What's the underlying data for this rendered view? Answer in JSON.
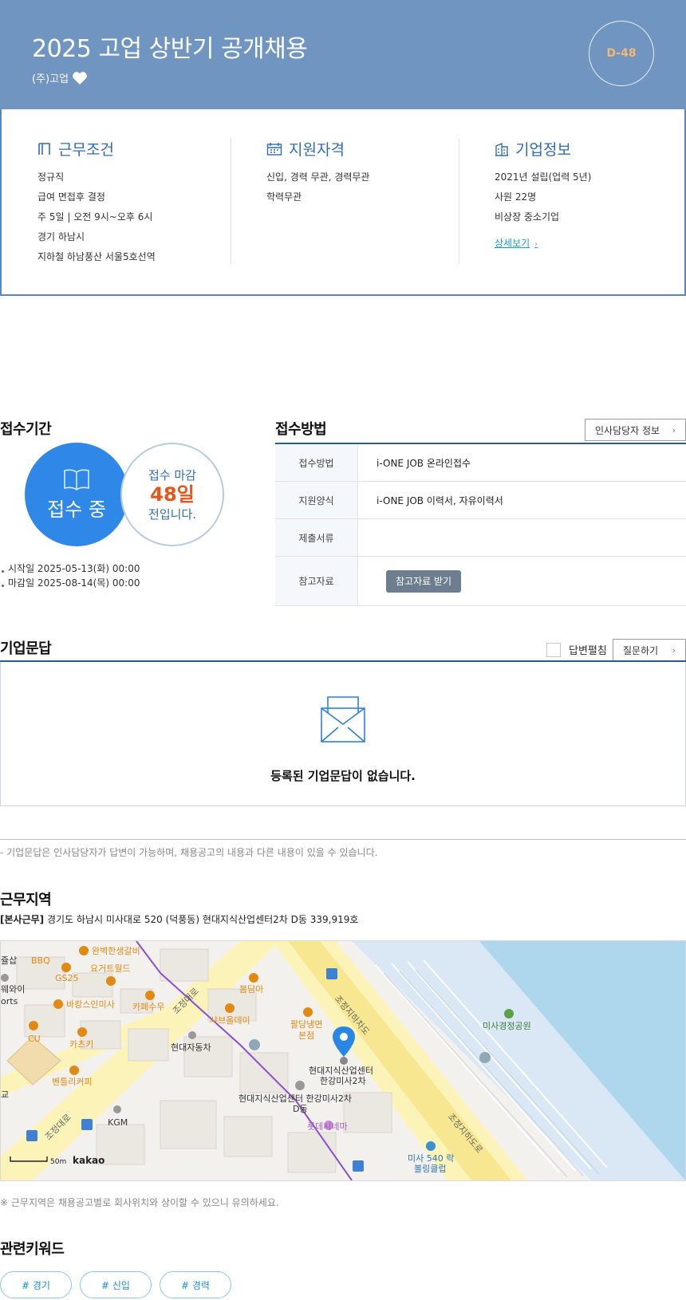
{
  "header": {
    "title": "2025 고업 상반기 공개채용",
    "company": "(주)고업",
    "dday": "D-48",
    "colors": {
      "banner": "#6f95c0",
      "accent": "#f3b77a"
    }
  },
  "summary": {
    "work_conditions": {
      "title": "근무조건",
      "lines": [
        "정규직",
        "급여 면접후 결정",
        "주 5일 | 오전 9시~오후 6시",
        "경기 하남시",
        "지하철 하남풍산 서울5호선역"
      ]
    },
    "qualifications": {
      "title": "지원자격",
      "lines": [
        "신입, 경력 무관, 경력무관",
        "학력무관"
      ]
    },
    "company_info": {
      "title": "기업정보",
      "lines": [
        "2021년 설립(업력 5년)",
        "사원 22명",
        "비상장 중소기업"
      ],
      "detail_link": "상세보기"
    }
  },
  "application_period": {
    "title": "접수기간",
    "status": "접수 중",
    "deadline_prefix": "접수 마감",
    "days_left": "48일",
    "deadline_suffix": "전입니다.",
    "start": "시작일 2025-05-13(화) 00:00",
    "end": "마감일 2025-08-14(목) 00:00"
  },
  "application_method": {
    "title": "접수방법",
    "hr_button": "인사담당자 정보",
    "rows": [
      {
        "label": "접수방법",
        "value": "i-ONE JOB 온라인접수"
      },
      {
        "label": "지원양식",
        "value": "i-ONE JOB 이력서, 자유이력서"
      },
      {
        "label": "제출서류",
        "value": ""
      },
      {
        "label": "참고자료",
        "button": "참고자료 받기"
      }
    ]
  },
  "qa": {
    "title": "기업문답",
    "expand_label": "답변펼침",
    "ask_button": "질문하기",
    "empty_message": "등록된 기업문답이 없습니다.",
    "note": "- 기업문답은 인사담당자가 답변이 가능하며, 채용공고의 내용과 다른 내용이 있을 수 있습니다."
  },
  "location": {
    "title": "근무지역",
    "tag": "[본사근무]",
    "address": "경기도 하남시 미사대로 520 (덕풍동) 현대지식산업센터2차 D동 339,919호",
    "note": "※ 근무지역은 채용공고별로 회사위치와 상이할 수 있으니 유의하세요.",
    "map": {
      "scale": "50m",
      "brand": "kakao",
      "labels": {
        "galbi": "완벽한생갈비",
        "bbq": "BBQ",
        "yogurt": "요거트월드",
        "gs25": "GS25",
        "bakang": "바캉스인미사",
        "cafe": "카페수우",
        "bomdam": "봄담아",
        "shabu": "샤브올데이",
        "paldang1": "팔당냉면",
        "paldang2": "본점",
        "hyundai_car": "현대자동차",
        "center1": "현대지식산업센터",
        "center2": "한강미사2차",
        "center_d1": "현대지식산업센터 한강미사2차",
        "center_d2": "D동",
        "lotte": "롯데시네마",
        "park": "미사경정공원",
        "katsu": "카츠키",
        "cu": "CU",
        "bentley": "벤틀리커피",
        "kgm": "KGM",
        "road1": "조정대로",
        "road2": "조정지하차도",
        "road3": "조정지하도로",
        "road4": "조정대로",
        "sap": "쥴삽",
        "wai": "웨와이",
        "orts": "orts",
        "gyo": "교",
        "club1": "미사 540 락",
        "club2": "볼링클럽"
      }
    }
  },
  "keywords": {
    "title": "관련키워드",
    "items": [
      "# 경기",
      "# 신입",
      "# 경력"
    ]
  }
}
